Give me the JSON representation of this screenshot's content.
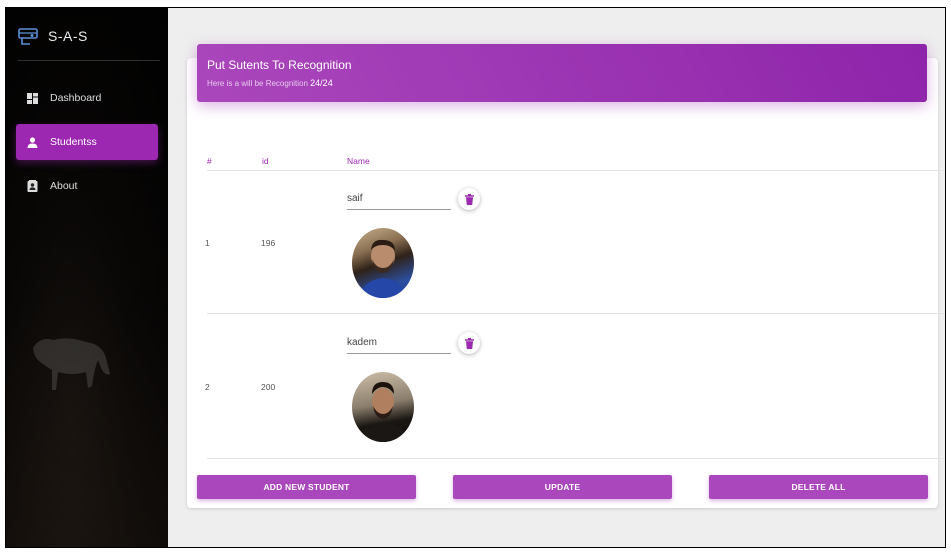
{
  "brand": {
    "title": "S-A-S",
    "icon": "projector-icon"
  },
  "sidebar": {
    "items": [
      {
        "label": "Dashboard",
        "icon": "dashboard-icon",
        "active": false
      },
      {
        "label": "Studentss",
        "icon": "person-icon",
        "active": true
      },
      {
        "label": "About",
        "icon": "contact-card-icon",
        "active": false
      }
    ]
  },
  "card": {
    "title": "Put Sutents To Recognition",
    "subtitle": "Here is a will be Recognition",
    "count": "24/24"
  },
  "table": {
    "headers": [
      "#",
      "id",
      "Name"
    ],
    "rows": [
      {
        "index": "1",
        "id": "196",
        "name": "saif"
      },
      {
        "index": "2",
        "id": "200",
        "name": "kadem"
      }
    ]
  },
  "actions": {
    "add": "ADD NEW STUDENT",
    "update": "UPDATE",
    "delete_all": "DELETE ALL"
  },
  "colors": {
    "accent": "#9c27b0",
    "background": "#eeeeee"
  }
}
